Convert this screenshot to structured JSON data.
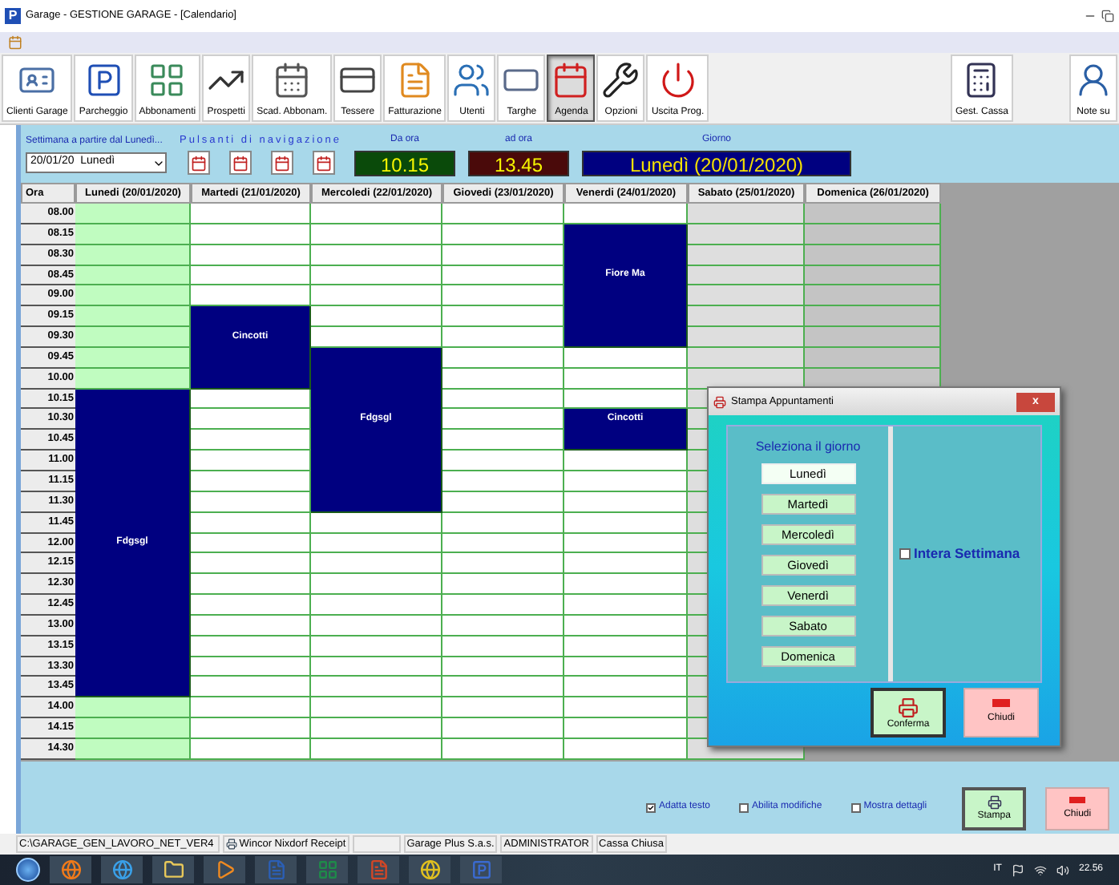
{
  "window": {
    "logo": "P",
    "title": "Garage - GESTIONE GARAGE - [Calendario]"
  },
  "toolbar": {
    "items": [
      {
        "label": "Clienti Garage",
        "kind": "client",
        "selected": false
      },
      {
        "label": "Parcheggio",
        "kind": "parking",
        "selected": false
      },
      {
        "label": "Abbonamenti",
        "kind": "subscriptions",
        "selected": false
      },
      {
        "label": "Prospetti",
        "kind": "charts",
        "selected": false
      },
      {
        "label": "Scad. Abbonam.",
        "kind": "deadlines",
        "selected": false
      },
      {
        "label": "Tessere",
        "kind": "cards",
        "selected": false
      },
      {
        "label": "Fatturazione",
        "kind": "invoice",
        "selected": false
      },
      {
        "label": "Utenti",
        "kind": "users",
        "selected": false
      },
      {
        "label": "Targhe",
        "kind": "plate",
        "selected": false
      },
      {
        "label": "Agenda",
        "kind": "agenda",
        "selected": true
      },
      {
        "label": "Opzioni",
        "kind": "tools",
        "selected": false
      },
      {
        "label": "Uscita Prog.",
        "kind": "exit",
        "selected": false
      }
    ],
    "right_items": [
      {
        "label": "Gest. Cassa",
        "kind": "cashier",
        "selected": false
      },
      {
        "label": "Note su",
        "kind": "notes",
        "selected": false
      }
    ]
  },
  "filter_bar": {
    "week_label": "Settimana a partire dal Lunedì...",
    "week_value": "20/01/20  Lunedì",
    "nav_label": "Pulsanti di navigazione",
    "from": {
      "label": "Da ora",
      "value": "10.15"
    },
    "to": {
      "label": "ad ora",
      "value": "13.45"
    },
    "day": {
      "label": "Giorno",
      "value": "Lunedì (20/01/2020)"
    }
  },
  "calendar": {
    "hour_header": "Ora",
    "times": [
      "08.00",
      "08.15",
      "08.30",
      "08.45",
      "09.00",
      "09.15",
      "09.30",
      "09.45",
      "10.00",
      "10.15",
      "10.30",
      "10.45",
      "11.00",
      "11.15",
      "11.30",
      "11.45",
      "12.00",
      "12.15",
      "12.30",
      "12.45",
      "13.00",
      "13.15",
      "13.30",
      "13.45",
      "14.00",
      "14.15",
      "14.30"
    ],
    "days": [
      {
        "header": "Lunedi (20/01/2020)",
        "kind": "weekday",
        "selected": true,
        "slots": [
          {
            "booked": false
          },
          {
            "booked": false
          },
          {
            "booked": false
          },
          {
            "booked": false
          },
          {
            "booked": false
          },
          {
            "booked": false
          },
          {
            "booked": false
          },
          {
            "booked": false
          },
          {
            "booked": false
          },
          {
            "booked": true
          },
          {
            "booked": true
          },
          {
            "booked": true
          },
          {
            "booked": true
          },
          {
            "booked": true
          },
          {
            "booked": true
          },
          {
            "booked": true
          },
          {
            "booked": true,
            "label": "Fdgsgl"
          },
          {
            "booked": true
          },
          {
            "booked": true
          },
          {
            "booked": true
          },
          {
            "booked": true
          },
          {
            "booked": true
          },
          {
            "booked": true
          },
          {
            "booked": true
          },
          {
            "booked": false
          },
          {
            "booked": false
          },
          {
            "booked": false
          }
        ]
      },
      {
        "header": "Martedi (21/01/2020)",
        "kind": "weekday",
        "selected": false,
        "slots": [
          {
            "booked": false
          },
          {
            "booked": false
          },
          {
            "booked": false
          },
          {
            "booked": false
          },
          {
            "booked": false
          },
          {
            "booked": true
          },
          {
            "booked": true,
            "label": "Cincotti"
          },
          {
            "booked": true
          },
          {
            "booked": true
          },
          {
            "booked": false
          },
          {
            "booked": false
          },
          {
            "booked": false
          },
          {
            "booked": false
          },
          {
            "booked": false
          },
          {
            "booked": false
          },
          {
            "booked": false
          },
          {
            "booked": false
          },
          {
            "booked": false
          },
          {
            "booked": false
          },
          {
            "booked": false
          },
          {
            "booked": false
          },
          {
            "booked": false
          },
          {
            "booked": false
          },
          {
            "booked": false
          },
          {
            "booked": false
          },
          {
            "booked": false
          },
          {
            "booked": false
          }
        ]
      },
      {
        "header": "Mercoledi (22/01/2020)",
        "kind": "weekday",
        "selected": false,
        "slots": [
          {
            "booked": false
          },
          {
            "booked": false
          },
          {
            "booked": false
          },
          {
            "booked": false
          },
          {
            "booked": false
          },
          {
            "booked": false
          },
          {
            "booked": false
          },
          {
            "booked": true
          },
          {
            "booked": true
          },
          {
            "booked": true
          },
          {
            "booked": true,
            "label": "Fdgsgl"
          },
          {
            "booked": true
          },
          {
            "booked": true
          },
          {
            "booked": true
          },
          {
            "booked": true
          },
          {
            "booked": false
          },
          {
            "booked": false
          },
          {
            "booked": false
          },
          {
            "booked": false
          },
          {
            "booked": false
          },
          {
            "booked": false
          },
          {
            "booked": false
          },
          {
            "booked": false
          },
          {
            "booked": false
          },
          {
            "booked": false
          },
          {
            "booked": false
          },
          {
            "booked": false
          }
        ]
      },
      {
        "header": "Giovedi (23/01/2020)",
        "kind": "weekday",
        "selected": false,
        "slots": [
          {
            "booked": false
          },
          {
            "booked": false
          },
          {
            "booked": false
          },
          {
            "booked": false
          },
          {
            "booked": false
          },
          {
            "booked": false
          },
          {
            "booked": false
          },
          {
            "booked": false
          },
          {
            "booked": false
          },
          {
            "booked": false
          },
          {
            "booked": false
          },
          {
            "booked": false
          },
          {
            "booked": false
          },
          {
            "booked": false
          },
          {
            "booked": false
          },
          {
            "booked": false
          },
          {
            "booked": false
          },
          {
            "booked": false
          },
          {
            "booked": false
          },
          {
            "booked": false
          },
          {
            "booked": false
          },
          {
            "booked": false
          },
          {
            "booked": false
          },
          {
            "booked": false
          },
          {
            "booked": false
          },
          {
            "booked": false
          },
          {
            "booked": false
          }
        ]
      },
      {
        "header": "Venerdi (24/01/2020)",
        "kind": "weekday",
        "selected": false,
        "slots": [
          {
            "booked": false
          },
          {
            "booked": true
          },
          {
            "booked": true
          },
          {
            "booked": true,
            "label": "Fiore Ma"
          },
          {
            "booked": true
          },
          {
            "booked": true
          },
          {
            "booked": true
          },
          {
            "booked": false
          },
          {
            "booked": false
          },
          {
            "booked": false
          },
          {
            "booked": true,
            "label": "Cincotti"
          },
          {
            "booked": true
          },
          {
            "booked": false
          },
          {
            "booked": false
          },
          {
            "booked": false
          },
          {
            "booked": false
          },
          {
            "booked": false
          },
          {
            "booked": false
          },
          {
            "booked": false
          },
          {
            "booked": false
          },
          {
            "booked": false
          },
          {
            "booked": false
          },
          {
            "booked": false
          },
          {
            "booked": false
          },
          {
            "booked": false
          },
          {
            "booked": false
          },
          {
            "booked": false
          }
        ]
      },
      {
        "header": "Sabato (25/01/2020)",
        "kind": "saturday",
        "selected": false,
        "slots": [
          {
            "booked": false
          },
          {
            "booked": false
          },
          {
            "booked": false
          },
          {
            "booked": false
          },
          {
            "booked": false
          },
          {
            "booked": false
          },
          {
            "booked": false
          },
          {
            "booked": false
          },
          {
            "booked": false
          },
          {
            "booked": false
          },
          {
            "booked": false
          },
          {
            "booked": false
          },
          {
            "booked": false
          },
          {
            "booked": false
          },
          {
            "booked": false
          },
          {
            "booked": false
          },
          {
            "booked": false
          },
          {
            "booked": false
          },
          {
            "booked": false
          },
          {
            "booked": false
          },
          {
            "booked": false
          },
          {
            "booked": false
          },
          {
            "booked": false
          },
          {
            "booked": false
          },
          {
            "booked": false
          },
          {
            "booked": false
          },
          {
            "booked": false
          }
        ]
      },
      {
        "header": "Domenica (26/01/2020)",
        "kind": "sunday",
        "selected": false,
        "slots": [
          {
            "booked": false
          },
          {
            "booked": false
          },
          {
            "booked": false
          },
          {
            "booked": false
          },
          {
            "booked": false
          },
          {
            "booked": false
          },
          {
            "booked": false
          },
          {
            "booked": false
          },
          {
            "booked": false
          }
        ]
      }
    ]
  },
  "dialog": {
    "title": "Stampa Appuntamenti",
    "close": "x",
    "prompt": "Seleziona il giorno",
    "days": [
      {
        "label": "Lunedì",
        "selected": true
      },
      {
        "label": "Martedì",
        "selected": false
      },
      {
        "label": "Mercoledì",
        "selected": false
      },
      {
        "label": "Giovedì",
        "selected": false
      },
      {
        "label": "Venerdì",
        "selected": false
      },
      {
        "label": "Sabato",
        "selected": false
      },
      {
        "label": "Domenica",
        "selected": false
      }
    ],
    "whole_week": {
      "label": "Intera Settimana",
      "checked": false
    },
    "buttons": [
      {
        "label": "Conferma",
        "kind": "confirm"
      },
      {
        "label": "Chiudi",
        "kind": "close"
      }
    ]
  },
  "options": [
    {
      "label": "Adatta testo",
      "checked": true
    },
    {
      "label": "Abilita modifiche",
      "checked": false
    },
    {
      "label": "Mostra dettagli",
      "checked": false
    }
  ],
  "actions": [
    {
      "label": "Stampa",
      "kind": "print"
    },
    {
      "label": "Chiudi",
      "kind": "close"
    }
  ],
  "status_bar": [
    {
      "text": "C:\\GARAGE_GEN_LAVORO_NET_VER4",
      "kind": "path"
    },
    {
      "text": "Wincor Nixdorf Receipt",
      "kind": "printer"
    },
    {
      "text": "Garage Plus S.a.s.",
      "kind": "plain"
    },
    {
      "text": "ADMINISTRATOR",
      "kind": "plain"
    },
    {
      "text": "Cassa Chiusa",
      "kind": "plain"
    }
  ],
  "taskbar": {
    "apps": [
      {
        "kind": "firefox"
      },
      {
        "kind": "ie"
      },
      {
        "kind": "folder"
      },
      {
        "kind": "media"
      },
      {
        "kind": "word"
      },
      {
        "kind": "excel"
      },
      {
        "kind": "powerpoint"
      },
      {
        "kind": "chrome"
      },
      {
        "kind": "parking"
      }
    ],
    "language": "IT",
    "time": "22.56"
  }
}
